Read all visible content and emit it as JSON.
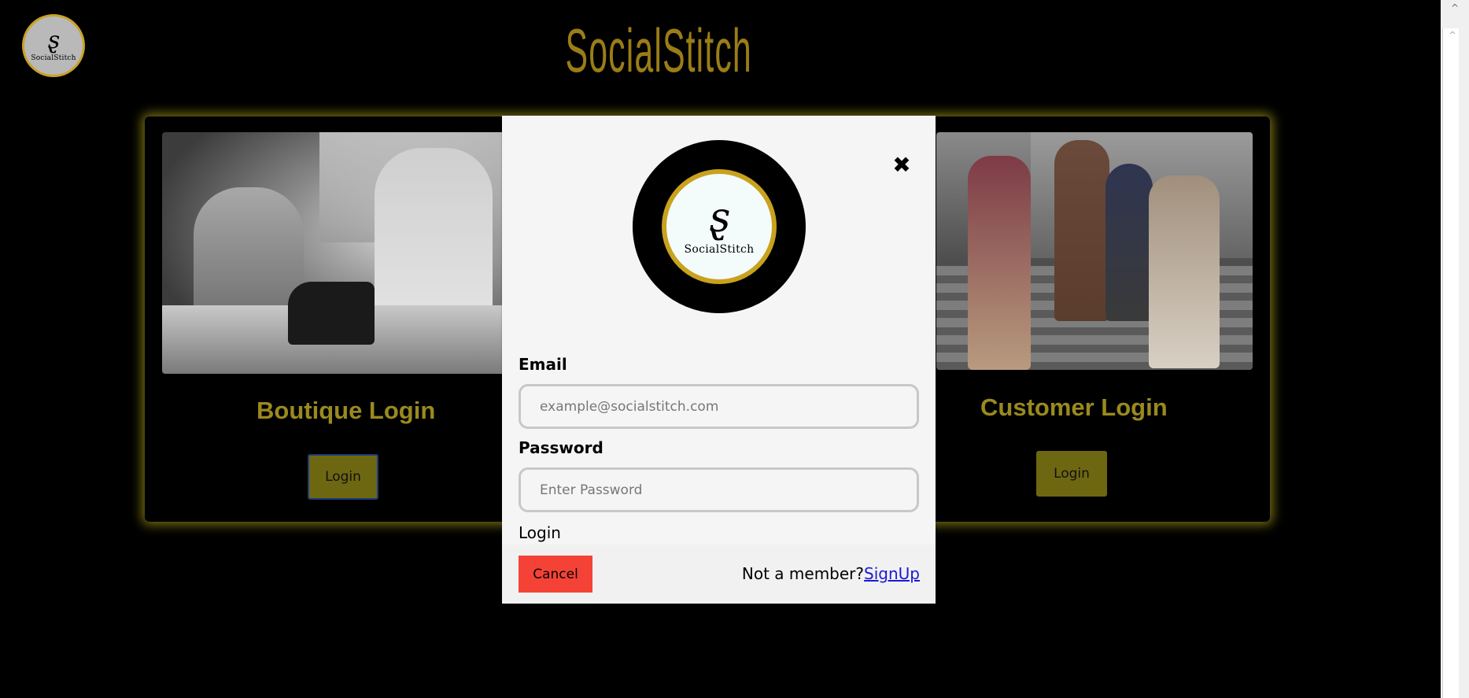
{
  "brand": {
    "title": "SocialStitch",
    "logo_text": "SocialStitch",
    "accent_color": "#9a7d16"
  },
  "cards": {
    "boutique": {
      "title": "Boutique Login",
      "button_label": "Login"
    },
    "customer": {
      "title": "Customer Login",
      "button_label": "Login"
    }
  },
  "modal": {
    "email_label": "Email",
    "email_placeholder": "example@socialstitch.com",
    "password_label": "Password",
    "password_placeholder": "Enter Password",
    "login_label": "Login",
    "cancel_label": "Cancel",
    "not_member_text": "Not a member?",
    "signup_label": "SignUp",
    "close_symbol": "✖"
  },
  "icons": {
    "close": "close-icon",
    "scroll_up": "chevron-up-icon"
  },
  "colors": {
    "cancel_button": "#f44336",
    "card_button": "#6e6711",
    "card_glow": "#d6c420"
  }
}
